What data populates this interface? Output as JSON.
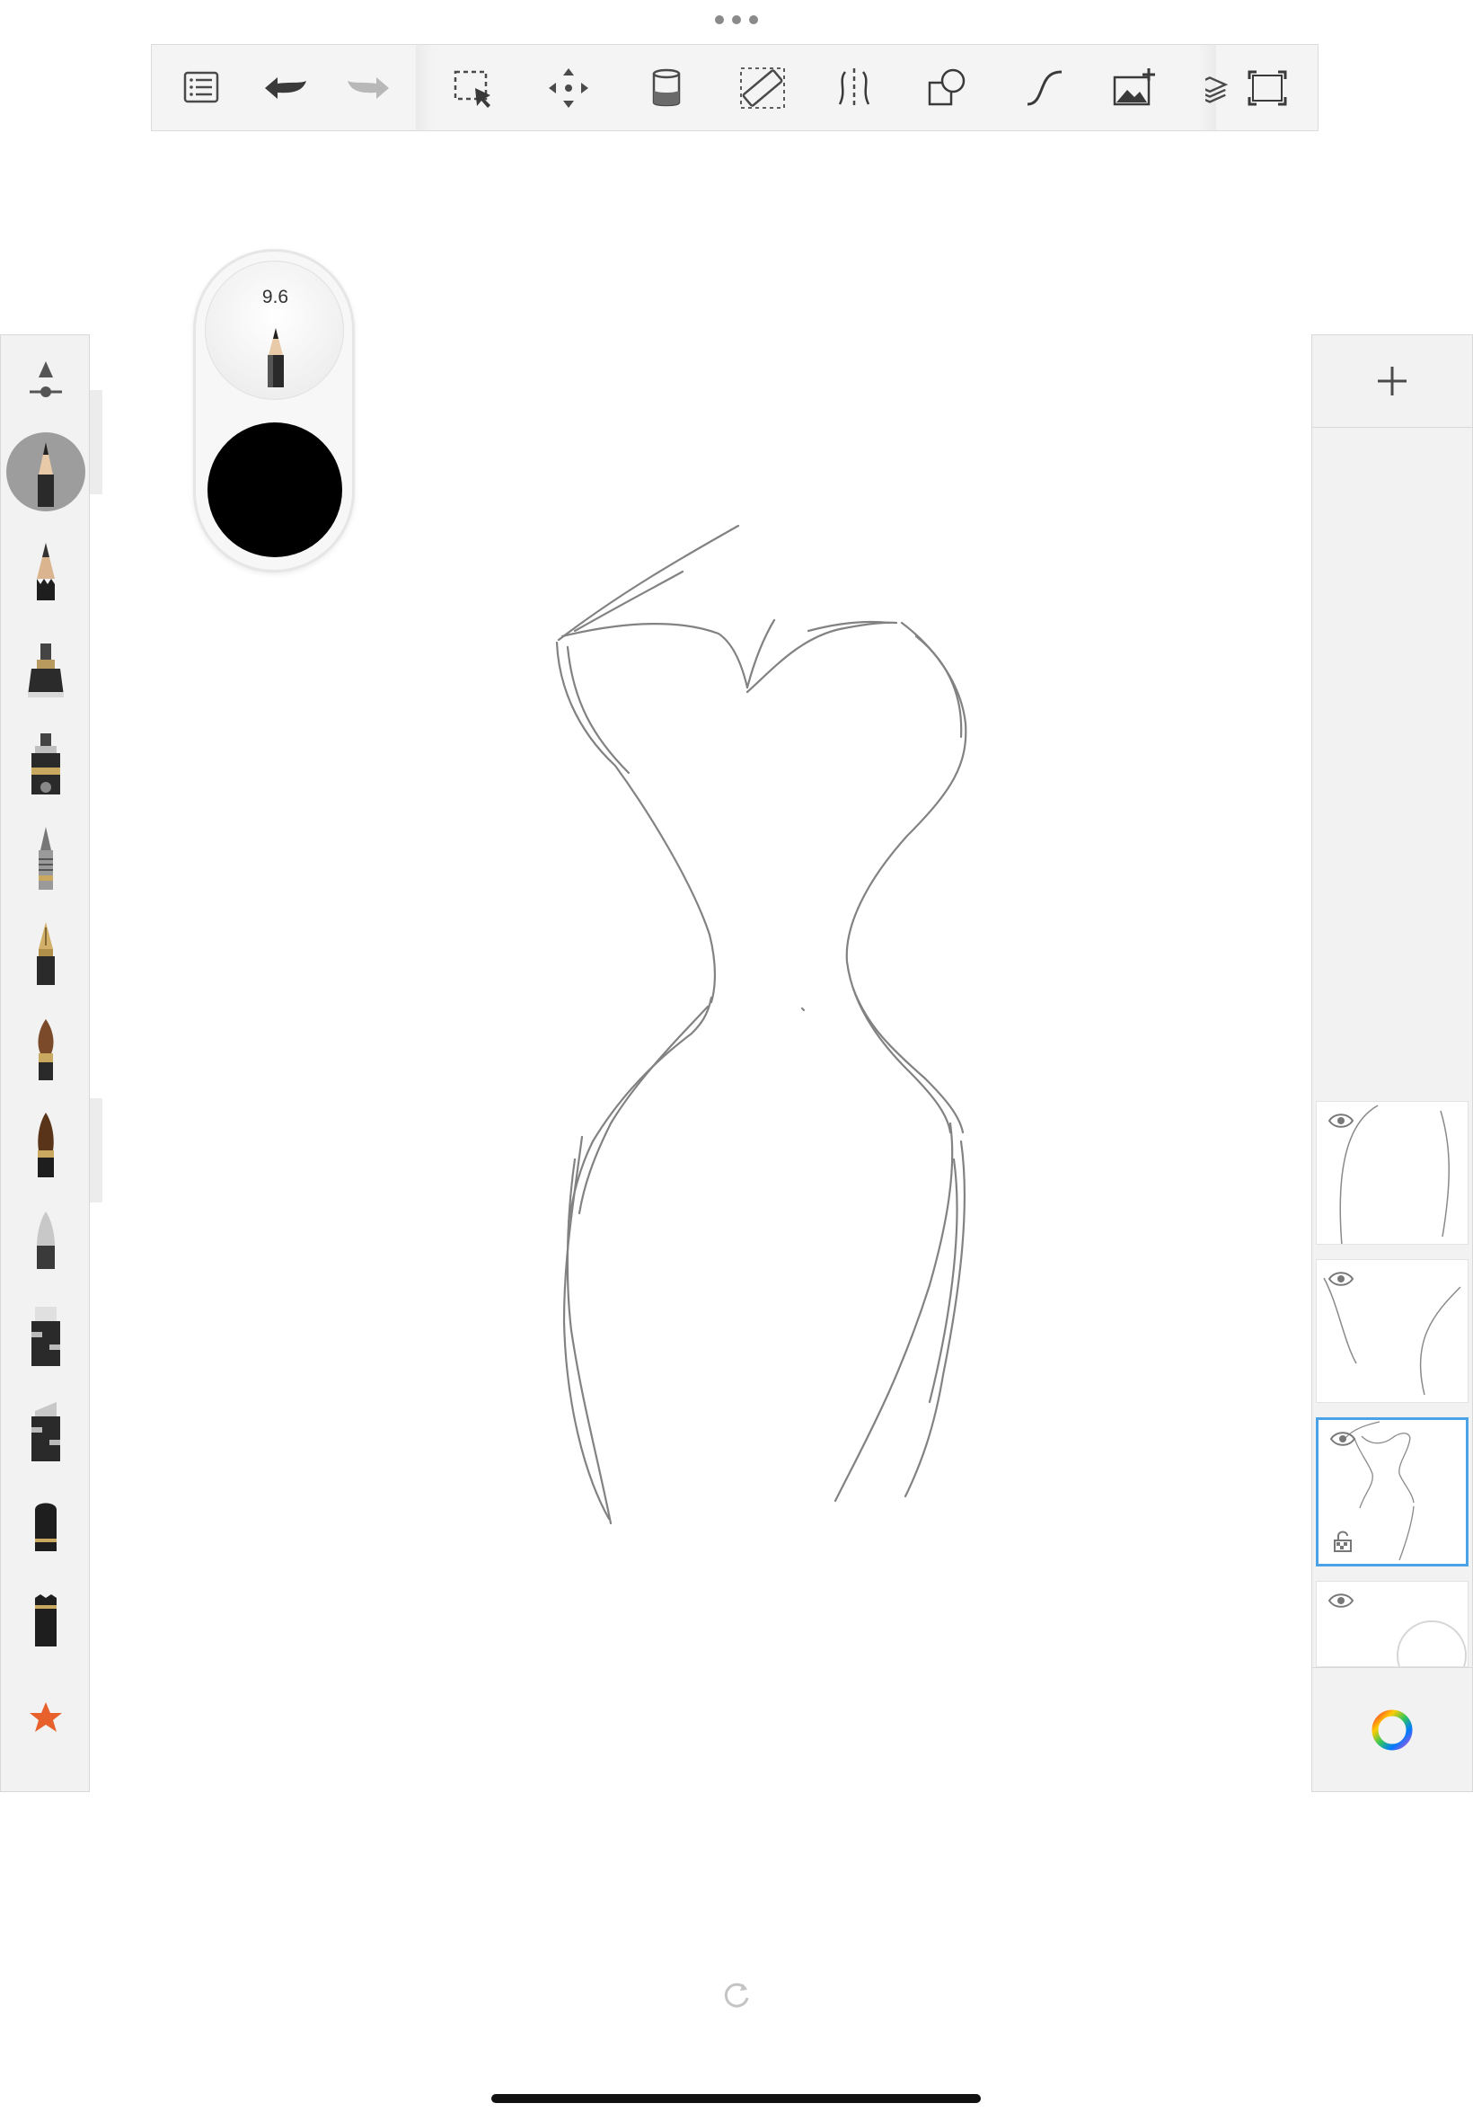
{
  "toolbar": {
    "buttons": [
      {
        "name": "menu",
        "icon": "list-icon"
      },
      {
        "name": "undo",
        "icon": "undo-arrow-icon"
      },
      {
        "name": "redo",
        "icon": "redo-arrow-icon"
      },
      {
        "name": "selection",
        "icon": "selection-icon"
      },
      {
        "name": "transform",
        "icon": "move-icon"
      },
      {
        "name": "fill",
        "icon": "fill-bucket-icon"
      },
      {
        "name": "ruler",
        "icon": "ruler-icon"
      },
      {
        "name": "symmetry",
        "icon": "symmetry-icon"
      },
      {
        "name": "shapes",
        "icon": "shapes-icon"
      },
      {
        "name": "stroke",
        "icon": "curve-icon"
      },
      {
        "name": "add-image",
        "icon": "add-image-icon"
      },
      {
        "name": "fullscreen",
        "icon": "fullscreen-icon"
      }
    ]
  },
  "brush_preview": {
    "size_value": "9.6",
    "color": "#000000"
  },
  "brushes": [
    {
      "name": "brush-settings",
      "icon": "brush-settings-icon"
    },
    {
      "name": "pencil",
      "icon": "pencil-icon",
      "selected": true
    },
    {
      "name": "pencil-2",
      "icon": "pencil-icon"
    },
    {
      "name": "marker",
      "icon": "marker-icon"
    },
    {
      "name": "ink-pen",
      "icon": "ink-pen-icon"
    },
    {
      "name": "ballpoint",
      "icon": "ballpoint-icon"
    },
    {
      "name": "fountain-pen",
      "icon": "fountain-pen-icon"
    },
    {
      "name": "brush",
      "icon": "paint-brush-icon"
    },
    {
      "name": "brush-2",
      "icon": "paint-brush-icon"
    },
    {
      "name": "airbrush",
      "icon": "airbrush-icon"
    },
    {
      "name": "chisel",
      "icon": "chisel-icon"
    },
    {
      "name": "chisel-2",
      "icon": "chisel-icon"
    },
    {
      "name": "eraser",
      "icon": "eraser-icon"
    },
    {
      "name": "eraser-2",
      "icon": "eraser-icon"
    },
    {
      "name": "favorites",
      "icon": "star-icon"
    }
  ],
  "layers": [
    {
      "name": "layer-4",
      "visible": true,
      "selected": false
    },
    {
      "name": "layer-3",
      "visible": true,
      "selected": false
    },
    {
      "name": "layer-2",
      "visible": true,
      "selected": true,
      "locked_transparency": true
    },
    {
      "name": "background",
      "visible": true,
      "selected": false
    }
  ],
  "colors": {
    "accent": "#4aa3e6",
    "panel_bg": "#f2f2f2",
    "favorites_star": "#e8602c"
  }
}
